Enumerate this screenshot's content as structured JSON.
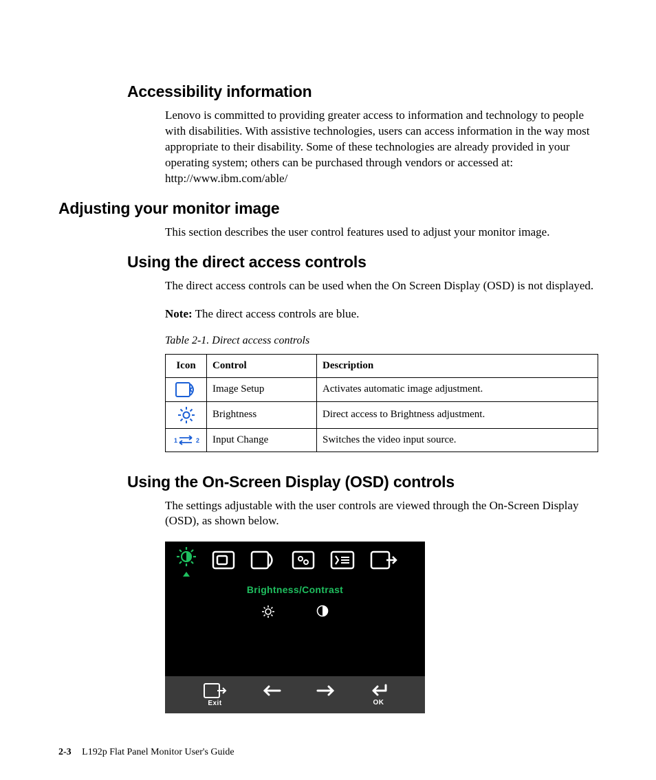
{
  "headings": {
    "accessibility": "Accessibility information",
    "adjusting": "Adjusting your monitor image",
    "direct_access": "Using the direct access controls",
    "osd_controls": "Using the On-Screen Display (OSD) controls"
  },
  "paragraphs": {
    "accessibility": "Lenovo is committed to providing greater access to information and technology to people with disabilities. With assistive technologies, users can access information in the way most appropriate to their disability. Some of these technologies are already provided in your operating system; others can be purchased through vendors or accessed at: http://www.ibm.com/able/",
    "adjusting": "This section describes the user control features used to adjust your monitor image.",
    "direct_access": "The direct access controls can be used when the On Screen Display (OSD) is not displayed.",
    "note_label": "Note:",
    "note_text": " The direct access controls are blue.",
    "osd": "The settings adjustable with the user controls are viewed through the On-Screen Display (OSD), as shown below."
  },
  "table": {
    "caption": "Table 2-1. Direct access controls",
    "headers": {
      "icon": "Icon",
      "control": "Control",
      "description": "Description"
    },
    "rows": [
      {
        "control": "Image Setup",
        "description": "Activates automatic image adjustment."
      },
      {
        "control": "Brightness",
        "description": "Direct access to Brightness adjustment."
      },
      {
        "control": "Input Change",
        "description": "Switches the video input source."
      }
    ],
    "icon_color": "#1a5fd6"
  },
  "osd": {
    "active_label": "Brightness/Contrast",
    "accent_color": "#1fbf5f",
    "top_icons": [
      "brightness-contrast",
      "image-position",
      "image-setup",
      "image-properties",
      "options",
      "exit"
    ],
    "sub_icons": [
      "brightness",
      "contrast"
    ],
    "bottom": {
      "exit": "Exit",
      "ok": "OK"
    }
  },
  "footer": {
    "page": "2-3",
    "title": "L192p Flat Panel Monitor User's Guide"
  }
}
